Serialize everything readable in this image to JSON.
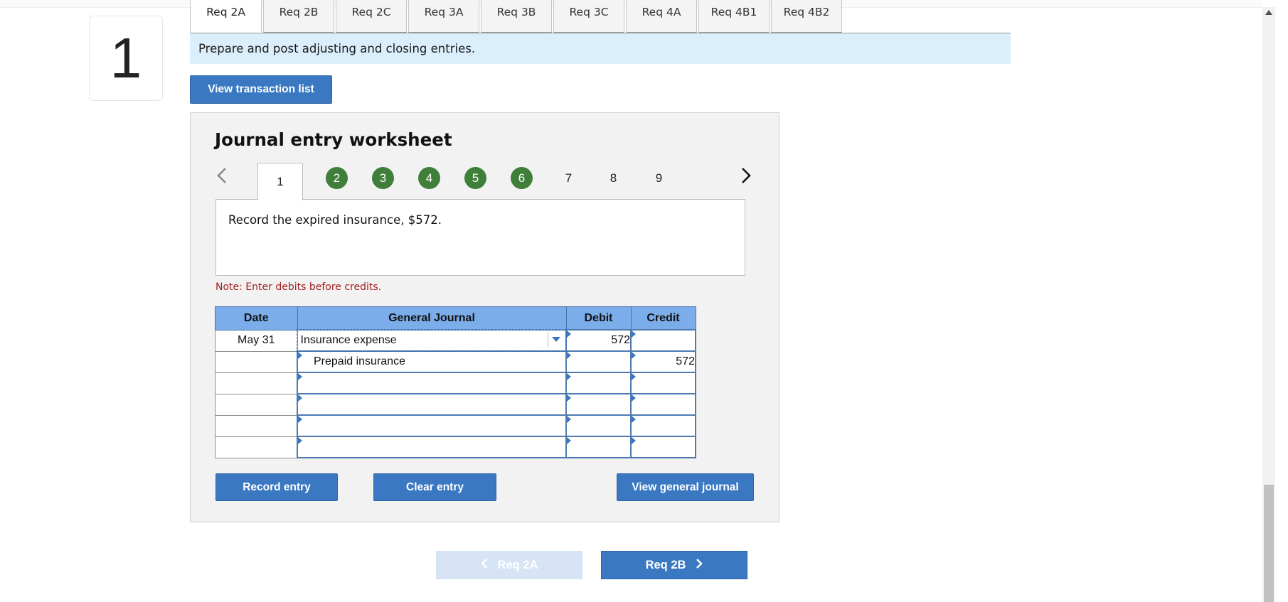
{
  "question_number": "1",
  "req_tabs": [
    "Req 2A",
    "Req 2B",
    "Req 2C",
    "Req 3A",
    "Req 3B",
    "Req 3C",
    "Req 4A",
    "Req 4B1",
    "Req 4B2"
  ],
  "banner_text": "Prepare and post adjusting and closing entries.",
  "view_transaction_list_label": "View transaction list",
  "worksheet": {
    "title": "Journal entry worksheet",
    "prev_arrow": "<",
    "next_arrow": ">",
    "steps": [
      "1",
      "2",
      "3",
      "4",
      "5",
      "6",
      "7",
      "8",
      "9"
    ],
    "completed_steps": [
      "2",
      "3",
      "4",
      "5",
      "6"
    ],
    "active_step": "1",
    "instruction": "Record the expired insurance, $572.",
    "note": "Note: Enter debits before credits.",
    "columns": [
      "Date",
      "General Journal",
      "Debit",
      "Credit"
    ],
    "rows": [
      {
        "date": "May 31",
        "account": "Insurance expense",
        "debit": "572",
        "credit": ""
      },
      {
        "date": "",
        "account": "Prepaid insurance",
        "debit": "",
        "credit": "572"
      },
      {
        "date": "",
        "account": "",
        "debit": "",
        "credit": ""
      },
      {
        "date": "",
        "account": "",
        "debit": "",
        "credit": ""
      },
      {
        "date": "",
        "account": "",
        "debit": "",
        "credit": ""
      },
      {
        "date": "",
        "account": "",
        "debit": "",
        "credit": ""
      }
    ],
    "record_entry_label": "Record entry",
    "clear_entry_label": "Clear entry",
    "view_general_journal_label": "View general journal"
  },
  "nav": {
    "prev_label": "Req 2A",
    "next_label": "Req 2B"
  },
  "colors": {
    "button_blue": "#3a78c2",
    "step_complete_green": "#3f7f3a",
    "table_header_blue": "#7badea",
    "banner_bg": "#dbeefc",
    "note_red": "#a31d1d"
  }
}
